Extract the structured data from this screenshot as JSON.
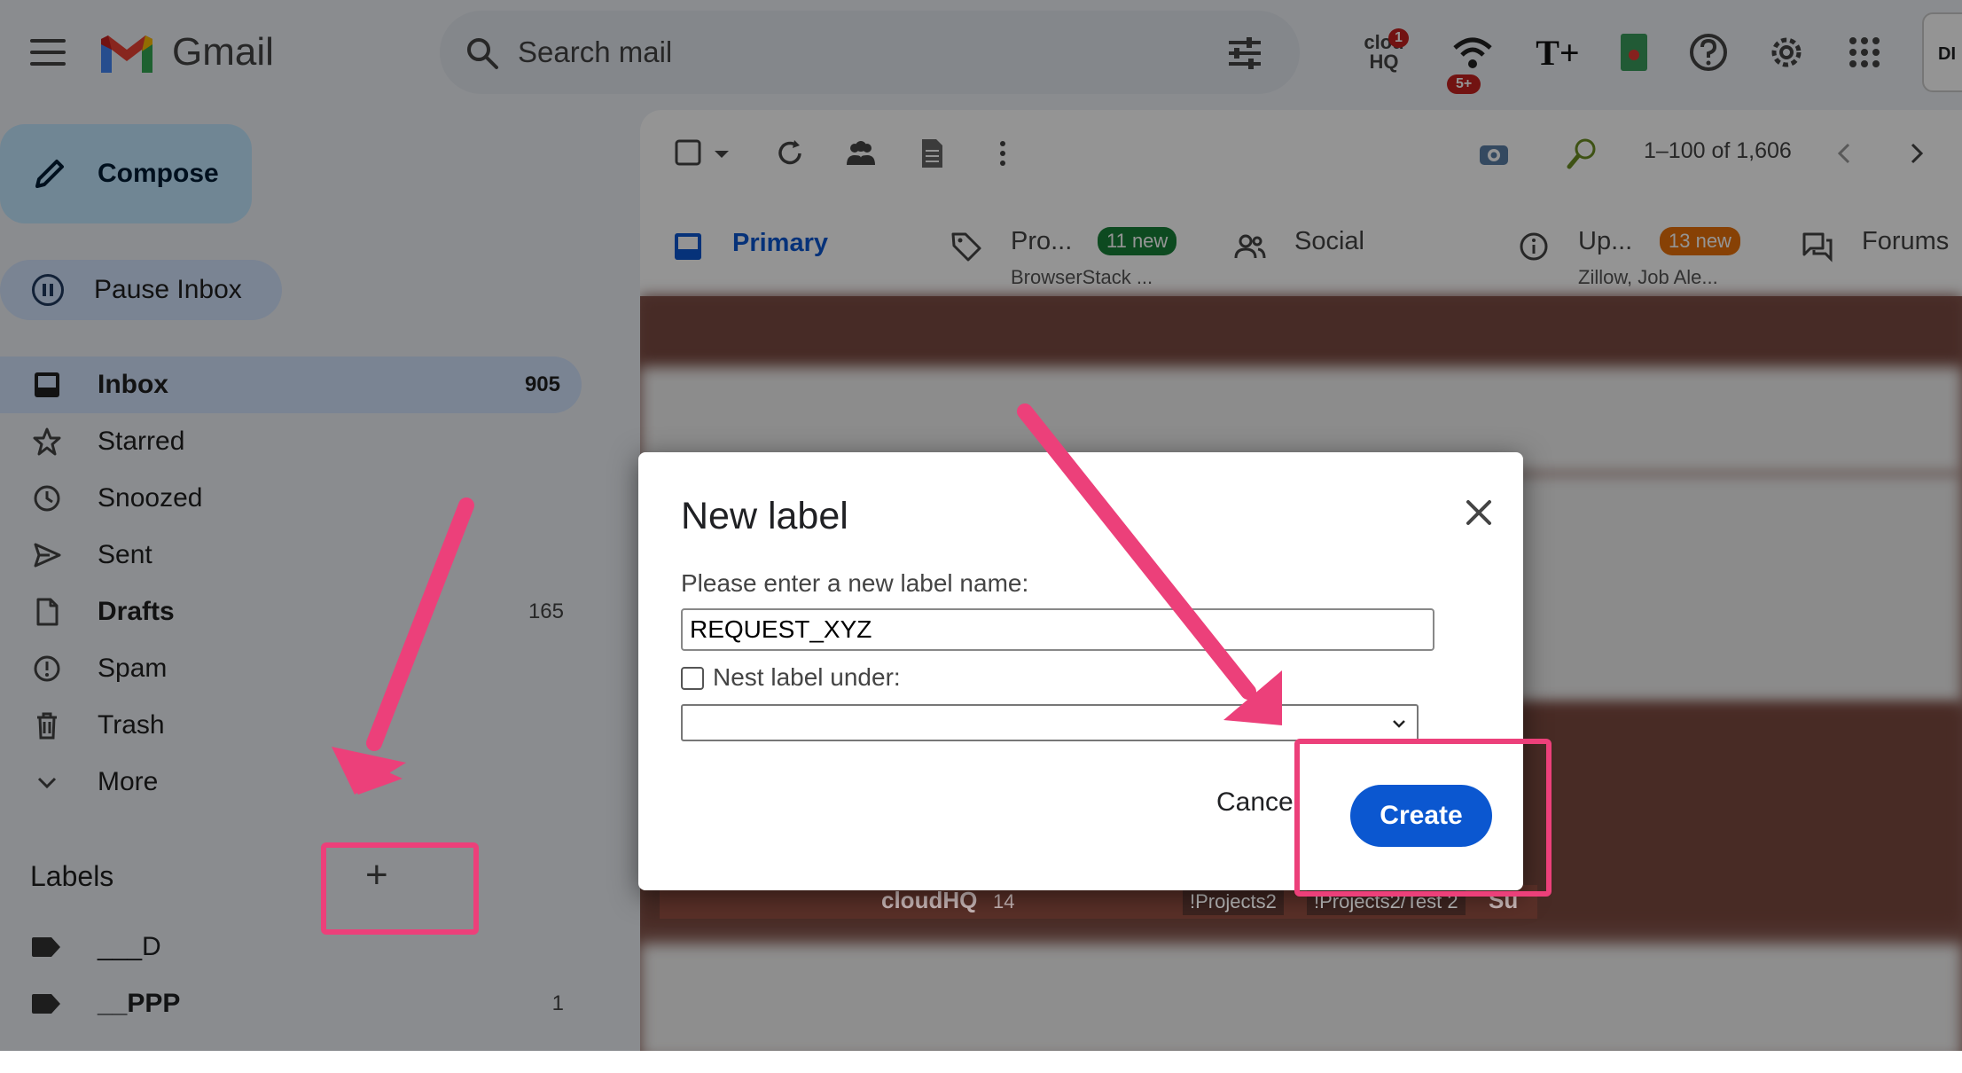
{
  "header": {
    "brand": "Gmail",
    "search_placeholder": "Search mail",
    "cloudhq_badge": "1",
    "wifi_badge": "5+",
    "avatar_text": "DI"
  },
  "sidebar": {
    "compose_label": "Compose",
    "pause_label": "Pause Inbox",
    "items": [
      {
        "label": "Inbox",
        "count": "905",
        "active": true,
        "bold": true
      },
      {
        "label": "Starred",
        "count": ""
      },
      {
        "label": "Snoozed",
        "count": ""
      },
      {
        "label": "Sent",
        "count": ""
      },
      {
        "label": "Drafts",
        "count": "165",
        "bold": true
      },
      {
        "label": "Spam",
        "count": ""
      },
      {
        "label": "Trash",
        "count": ""
      },
      {
        "label": "More",
        "count": ""
      }
    ],
    "labels_heading": "Labels",
    "labels_add": "+",
    "labels": [
      {
        "label": "___D",
        "count": ""
      },
      {
        "label": "__PPP",
        "count": "1"
      }
    ]
  },
  "toolbar": {
    "pager": "1–100 of 1,606"
  },
  "tabs": {
    "primary": "Primary",
    "promotions": {
      "title": "Pro...",
      "badge": "11 new",
      "sub": "BrowserStack ..."
    },
    "social": "Social",
    "updates": {
      "title": "Up...",
      "badge": "13 new",
      "sub": "Zillow, Job Ale..."
    },
    "forums": "Forums"
  },
  "background_row": {
    "sender": "cloudHQ",
    "count": "14",
    "chip1": "!Projects2",
    "chip2": "!Projects2/Test 2",
    "snippet": "Su"
  },
  "dialog": {
    "title": "New label",
    "prompt": "Please enter a new label name:",
    "input_value": "REQUEST_XYZ",
    "nest_label": "Nest label under:",
    "cancel_label": "Cancel",
    "create_label": "Create"
  },
  "colors": {
    "accent_blue": "#0b57d0",
    "annotation_pink": "#ec407a",
    "promotions_badge": "#188038",
    "updates_badge": "#e8710a"
  }
}
